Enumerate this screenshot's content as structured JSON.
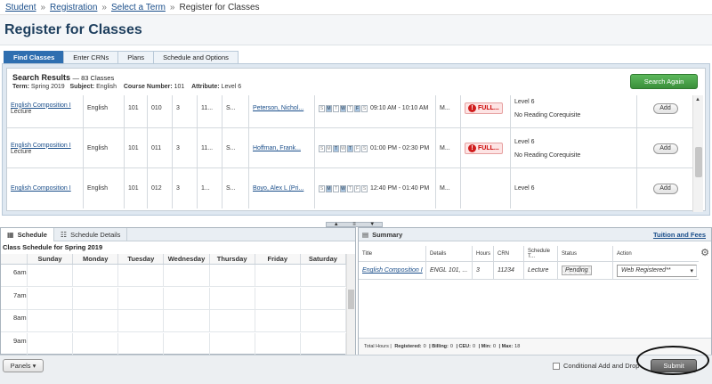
{
  "breadcrumb": {
    "items": [
      "Student",
      "Registration",
      "Select a Term",
      "Register for Classes"
    ],
    "separator": "»"
  },
  "page_title": "Register for Classes",
  "tabs": [
    "Find Classes",
    "Enter CRNs",
    "Plans",
    "Schedule and Options"
  ],
  "search_results": {
    "heading": "Search Results",
    "count": "— 83 Classes",
    "term_label": "Term:",
    "term_value": "Spring 2019",
    "subject_label": "Subject:",
    "subject_value": "English",
    "course_label": "Course Number:",
    "course_value": "101",
    "attribute_label": "Attribute:",
    "attribute_value": "Level 6",
    "search_again": "Search Again",
    "rows": [
      {
        "title": "English Composition I",
        "type": "Lecture",
        "subject": "English",
        "course": "101",
        "section": "010",
        "hours": "3",
        "crn": "11...",
        "term": "S...",
        "instructor": "Peterson, Nichol...",
        "days_on": [
          1,
          3,
          5
        ],
        "time": "09:10 AM - 10:10 AM",
        "campus": "M...",
        "status": "FULL...",
        "attr1": "Level 6",
        "attr2": "No Reading Corequisite",
        "add": "Add"
      },
      {
        "title": "English Composition I",
        "type": "Lecture",
        "subject": "English",
        "course": "101",
        "section": "011",
        "hours": "3",
        "crn": "11...",
        "term": "S...",
        "instructor": "Hoffman, Frank...",
        "days_on": [
          2,
          4
        ],
        "time": "01:00 PM - 02:30 PM",
        "campus": "M...",
        "status": "FULL...",
        "attr1": "Level 6",
        "attr2": "No Reading Corequisite",
        "add": "Add"
      },
      {
        "title": "English Composition I",
        "type": "",
        "subject": "English",
        "course": "101",
        "section": "012",
        "hours": "3",
        "crn": "1...",
        "term": "S...",
        "instructor": "Boyo, Alex L (Pri...",
        "days_on": [
          1,
          3
        ],
        "time": "12:40 PM - 01:40 PM",
        "campus": "M...",
        "status": "",
        "attr1": "Level 6",
        "attr2": "",
        "add": "Add"
      }
    ],
    "day_letters": [
      "S",
      "M",
      "T",
      "W",
      "T",
      "F",
      "S"
    ]
  },
  "schedule_panel": {
    "tabs": [
      "Schedule",
      "Schedule Details"
    ],
    "title": "Class Schedule for Spring 2019",
    "days": [
      "Sunday",
      "Monday",
      "Tuesday",
      "Wednesday",
      "Thursday",
      "Friday",
      "Saturday"
    ],
    "times": [
      "6am",
      "7am",
      "8am",
      "9am"
    ]
  },
  "summary_panel": {
    "title": "Summary",
    "tuition_link": "Tuition and Fees",
    "columns": [
      "Title",
      "Details",
      "Hours",
      "CRN",
      "Schedule T...",
      "Status",
      "Action"
    ],
    "row": {
      "title": "English Composition I",
      "details": "ENGL 101, ...",
      "hours": "3",
      "crn": "11234",
      "schedule_type": "Lecture",
      "status": "Pending",
      "action": "Web Registered**"
    },
    "totals": {
      "total_hours": "Total Hours |",
      "registered": "Registered:",
      "registered_v": "0",
      "billing": "| Billing:",
      "billing_v": "0",
      "ceu": "| CEU:",
      "ceu_v": "0",
      "min": "| Min:",
      "min_v": "0",
      "max": "| Max:",
      "max_v": "18"
    }
  },
  "footer": {
    "panels": "Panels",
    "conditional": "Conditional Add and Drop",
    "submit": "Submit"
  }
}
